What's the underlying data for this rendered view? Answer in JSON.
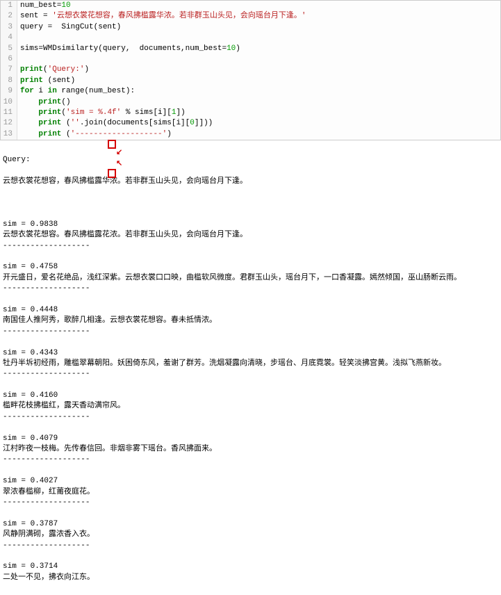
{
  "code": {
    "num_best": "10",
    "sent_string": "'云想衣裳花想容，春风拂槛露华浓。若非群玉山头见，会向瑶台月下逢。'",
    "line1_a": "num_best=",
    "line2_a": "sent = ",
    "line3": "query =  SingCut(sent)",
    "line5_a": "sims=",
    "line5_b": "WMDsimilarty",
    "line5_c": "(query,  documents,num_best=",
    "line5_d": "10",
    "line5_e": ")",
    "line7_a": "print",
    "line7_b": "(",
    "line7_str": "'Query:'",
    "line7_d": ")",
    "line8": "print",
    "line8_b": " (sent)",
    "line9_a": "for",
    "line9_b": " i ",
    "line9_c": "in",
    "line9_d": " range(num_best):",
    "line10_a": "    print",
    "line10_b": "()",
    "line11_a": "    print",
    "line11_b": "(",
    "line11_str": "'sim = %.4f'",
    "line11_c": " % sims[i][",
    "line11_num": "1",
    "line11_d": "])",
    "line12_a": "    print",
    "line12_b": " (",
    "line12_str": "''",
    "line12_c": ".join(documents[sims[i][",
    "line12_num": "0",
    "line12_d": "]]))",
    "line13_a": "    print",
    "line13_b": " (",
    "line13_str": "'-------------------'",
    "line13_c": ")"
  },
  "output": {
    "query_label": "Query:",
    "query_text": "云想衣裳花想容，春风拂槛露华浓。若非群玉山头见，会向瑶台月下逢。",
    "sep": "-------------------",
    "results": [
      {
        "sim": "sim = 0.9838",
        "text": "云想衣裳花想容。春风拂槛露花浓。若非群玉山头见，会向瑶台月下逢。"
      },
      {
        "sim": "sim = 0.4758",
        "text": "开元盛日，爱名花绝品，浅红深紫。云想衣裳口口映，曲槛软风微度。君群玉山头，瑶台月下，一口香凝露。嫣然倾国，巫山肠断云雨。"
      },
      {
        "sim": "sim = 0.4448",
        "text": "南国佳人推阿秀，歌醉几相逢。云想衣裳花想容。春未抵情浓。"
      },
      {
        "sim": "sim = 0.4343",
        "text": "牡丹半坼初经雨，雕槛翠幕朝阳。妖困倚东风，羞谢了群芳。洗烟凝露向清晓，步瑶台、月底霓裳。轻笑淡拂宫黄。浅拟飞燕新妆。"
      },
      {
        "sim": "sim = 0.4160",
        "text": "槛畔花枝拂槛红，露天香动满帘风。"
      },
      {
        "sim": "sim = 0.4079",
        "text": "江村昨夜一枝梅。先传春信回。非烟非雾下瑶台。香风拂面来。"
      },
      {
        "sim": "sim = 0.4027",
        "text": "翠浓春槛柳，红莆夜庭花。"
      },
      {
        "sim": "sim = 0.3787",
        "text": "风静阴满砌，露浓香入衣。"
      },
      {
        "sim": "sim = 0.3714",
        "text": "二处一不见，拂衣向江东。"
      }
    ]
  },
  "line_numbers": [
    "1",
    "2",
    "3",
    "4",
    "5",
    "6",
    "7",
    "8",
    "9",
    "10",
    "11",
    "12",
    "13"
  ]
}
